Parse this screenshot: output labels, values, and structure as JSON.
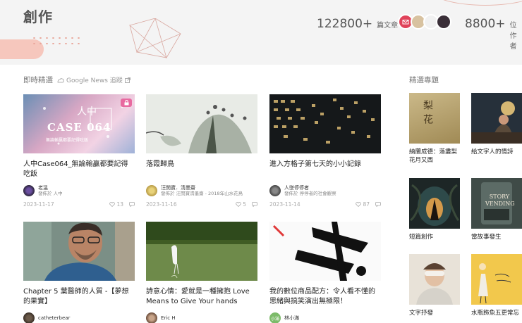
{
  "header": {
    "title": "創作",
    "articles_count": "122800+",
    "articles_unit": "篇文章",
    "writers_count": "8800+",
    "writers_unit": "位作者"
  },
  "latest": {
    "heading": "即時精選",
    "gnews_label": "Google News 追蹤"
  },
  "featured_heading": "精選專題",
  "cards": [
    {
      "title": "人中Case064_無論輸贏都要記得吃飯",
      "author": "老溫",
      "publication": "發佈於 人中",
      "date": "2023-11-17",
      "likes": "13",
      "thumb_text": "CASE 064",
      "thumb_sub": "人中",
      "thumb_caption": "無論輸贏都要記得吃飯"
    },
    {
      "title": "落霞歸鳥",
      "author": "汪閔寶．淸墨齋",
      "publication": "發佈於 汪閔寶淸墨齋 - 2018年山水花鳥",
      "date": "2023-11-16",
      "likes": "5"
    },
    {
      "title": "進入方格子第七天的小小記錄",
      "author": "人墜停停者",
      "publication": "發佈於 停停者的社會觀察",
      "date": "2023-11-14",
      "likes": "87"
    },
    {
      "title": "Chapter 5 葉醫師的人質 -【夢想的果實】",
      "author": "catheterbear",
      "publication": "",
      "date": "",
      "likes": ""
    },
    {
      "title": "詩意心情：愛就是一種擁抱 Love Means to Give Your hands",
      "author": "Eric H",
      "publication": "",
      "date": "",
      "likes": ""
    },
    {
      "title": "我的數位商品配方：令人看不懂的思緒與搞笑演出無極限！",
      "author": "林小滿",
      "publication": "",
      "date": "",
      "likes": "",
      "avatar_text": "小滿"
    }
  ],
  "topics": [
    {
      "label": "納蘭成德：落盡梨花月又西",
      "img_text": "梨花"
    },
    {
      "label": "給文字人的情詩",
      "img_text": ""
    },
    {
      "label": "短篇創作",
      "img_text": ""
    },
    {
      "label": "當故事發生",
      "img_text": "STORY VENDING"
    },
    {
      "label": "文字抒發",
      "img_text": ""
    },
    {
      "label": "水瓶飾魚五更常忘",
      "img_text": ""
    }
  ],
  "icons": [
    "lock-icon",
    "google-news-icon",
    "external-link-icon",
    "heart-icon",
    "comment-icon"
  ],
  "colors": {
    "accent_pink": "#e86aa0",
    "deco_pink": "#f6c7bd",
    "header_bg": "#f4f4f4"
  }
}
